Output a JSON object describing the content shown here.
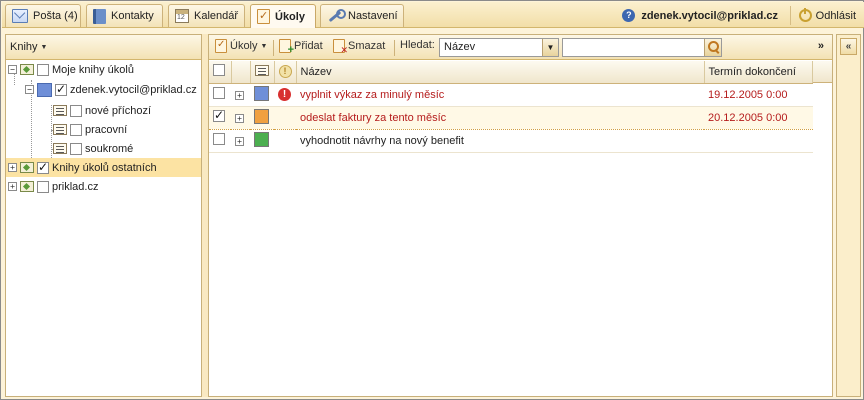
{
  "tabs": [
    {
      "label": "Pošta (4)",
      "icon": "mail-icon"
    },
    {
      "label": "Kontakty",
      "icon": "address-book-icon"
    },
    {
      "label": "Kalendář",
      "icon": "calendar-icon"
    },
    {
      "label": "Úkoly",
      "icon": "tasks-icon",
      "active": true
    },
    {
      "label": "Nastavení",
      "icon": "wrench-icon"
    }
  ],
  "user": {
    "email": "zdenek.vytocil@priklad.cz",
    "logout_label": "Odhlásit"
  },
  "sidebar": {
    "header_label": "Knihy",
    "tree": [
      {
        "label": "Moje knihy úkolů",
        "checked": false
      },
      {
        "label": "zdenek.vytocil@priklad.cz",
        "checked": true,
        "color": "#6f8fd8"
      },
      {
        "label": "nové příchozí",
        "checked": false
      },
      {
        "label": "pracovní",
        "checked": false
      },
      {
        "label": "soukromé",
        "checked": false
      },
      {
        "label": "Knihy úkolů ostatních",
        "checked": true,
        "selected": true
      },
      {
        "label": "priklad.cz",
        "checked": false
      }
    ]
  },
  "toolbar": {
    "tasks_label": "Úkoly",
    "add_label": "Přidat",
    "delete_label": "Smazat",
    "search_label": "Hledat:",
    "search_field_value": "Název",
    "search_input_value": "",
    "more_label": "»"
  },
  "table": {
    "columns": [
      "Název",
      "Termín dokončení"
    ],
    "rows": [
      {
        "name": "vyplnit výkaz za minulý měsíc",
        "due": "19.12.2005 0:00",
        "color": "#6f8fd8",
        "high_priority": true,
        "checked": false,
        "overdue": true
      },
      {
        "name": "odeslat faktury za tento měsíc",
        "due": "20.12.2005 0:00",
        "color": "#f0a040",
        "high_priority": false,
        "checked": true,
        "overdue": true
      },
      {
        "name": "vyhodnotit návrhy na nový benefit",
        "due": "",
        "color": "#4caf50",
        "high_priority": false,
        "checked": false,
        "overdue": false
      }
    ]
  },
  "right_panel": {
    "toggle_label": "«"
  }
}
